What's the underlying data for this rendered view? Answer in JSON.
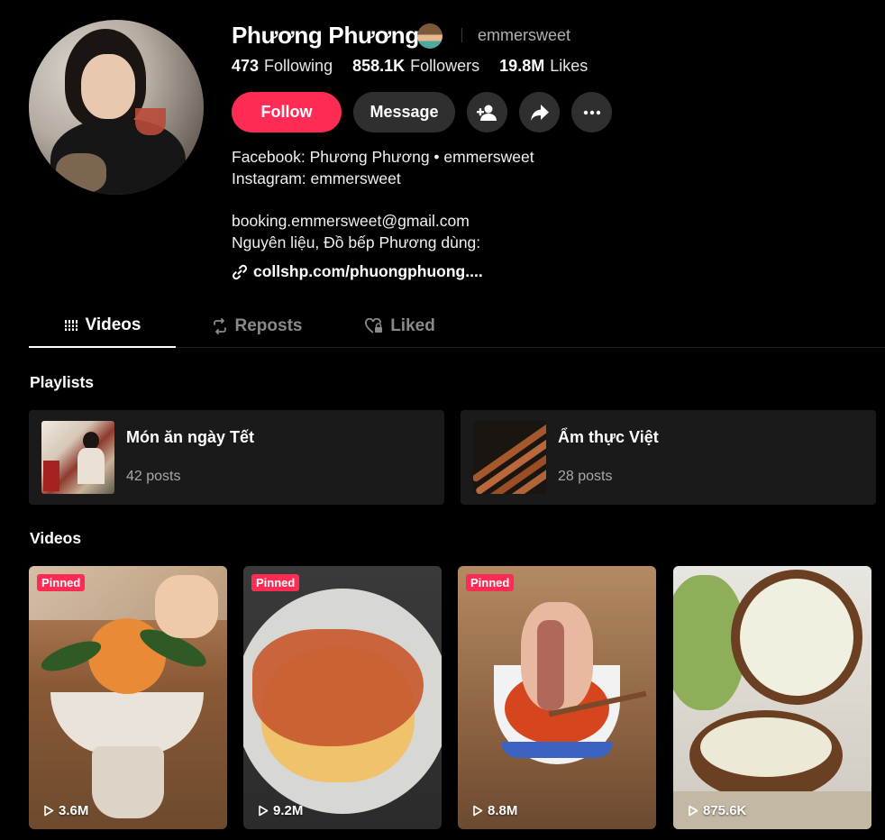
{
  "profile": {
    "name": "Phương Phương",
    "handle": "emmersweet",
    "stats": [
      {
        "value": "473",
        "label": "Following"
      },
      {
        "value": "858.1K",
        "label": "Followers"
      },
      {
        "value": "19.8M",
        "label": "Likes"
      }
    ],
    "follow_label": "Follow",
    "message_label": "Message",
    "bio_lines": [
      "Facebook: Phương Phương • emmersweet",
      "Instagram: emmersweet",
      "booking.emmersweet@gmail.com",
      "Nguyên liệu, Đồ bếp Phương dùng:"
    ],
    "link": "collshp.com/phuongphuong...."
  },
  "tabs": [
    {
      "label": "Videos",
      "icon": "grid-icon",
      "active": true
    },
    {
      "label": "Reposts",
      "icon": "repost-icon",
      "active": false
    },
    {
      "label": "Liked",
      "icon": "heart-icon",
      "active": false
    }
  ],
  "sections": {
    "playlists_title": "Playlists",
    "videos_title": "Videos"
  },
  "playlists": [
    {
      "title": "Món ăn ngày Tết",
      "count": "42 posts"
    },
    {
      "title": "Ẩm thực Việt",
      "count": "28 posts"
    }
  ],
  "videos": [
    {
      "pinned": "Pinned",
      "views": "3.6M"
    },
    {
      "pinned": "Pinned",
      "views": "9.2M"
    },
    {
      "pinned": "Pinned",
      "views": "8.8M"
    },
    {
      "pinned": "",
      "views": "875.6K"
    }
  ],
  "colors": {
    "accent": "#fe2c55",
    "button_bg": "#2f2f2f",
    "card_bg": "#1a1a1a"
  }
}
